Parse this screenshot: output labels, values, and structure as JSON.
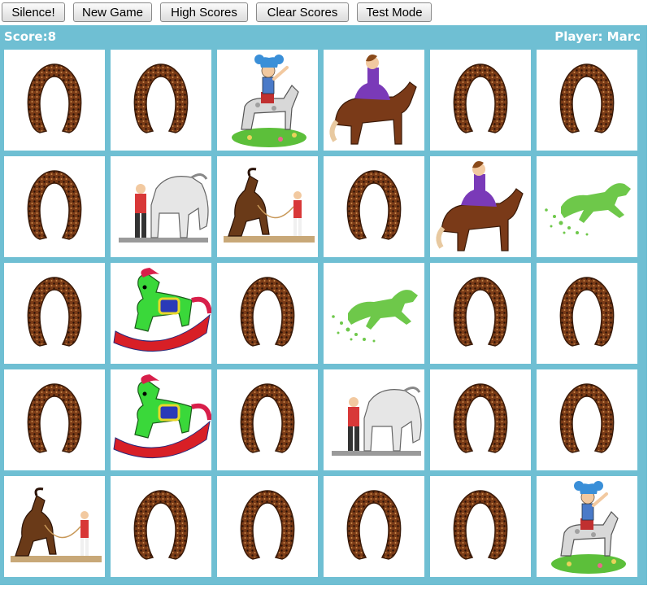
{
  "toolbar": {
    "silence_label": "Silence!",
    "new_game_label": "New Game",
    "high_scores_label": "High Scores",
    "clear_scores_label": "Clear Scores",
    "test_mode_label": "Test Mode"
  },
  "status": {
    "score_text": "Score:8",
    "player_text": "Player: Marc"
  },
  "colors": {
    "board_background": "#6fbfd3",
    "card_background": "#ffffff",
    "horseshoe": "#6b3417",
    "status_text": "#ffffff"
  },
  "board": {
    "rows": 5,
    "columns": 6,
    "cards": [
      [
        "horseshoe-back",
        "horseshoe-back",
        "boy-on-pony",
        "girl-on-horse",
        "horseshoe-back",
        "horseshoe-back"
      ],
      [
        "horseshoe-back",
        "groom-with-gray-horse",
        "rearing-horse-trainer",
        "horseshoe-back",
        "girl-on-horse",
        "green-galloping-horse"
      ],
      [
        "horseshoe-back",
        "rocking-horse",
        "horseshoe-back",
        "green-galloping-horse",
        "horseshoe-back",
        "horseshoe-back"
      ],
      [
        "horseshoe-back",
        "rocking-horse",
        "horseshoe-back",
        "groom-with-gray-horse",
        "horseshoe-back",
        "horseshoe-back"
      ],
      [
        "rearing-horse-trainer",
        "horseshoe-back",
        "horseshoe-back",
        "horseshoe-back",
        "horseshoe-back",
        "boy-on-pony"
      ]
    ]
  }
}
